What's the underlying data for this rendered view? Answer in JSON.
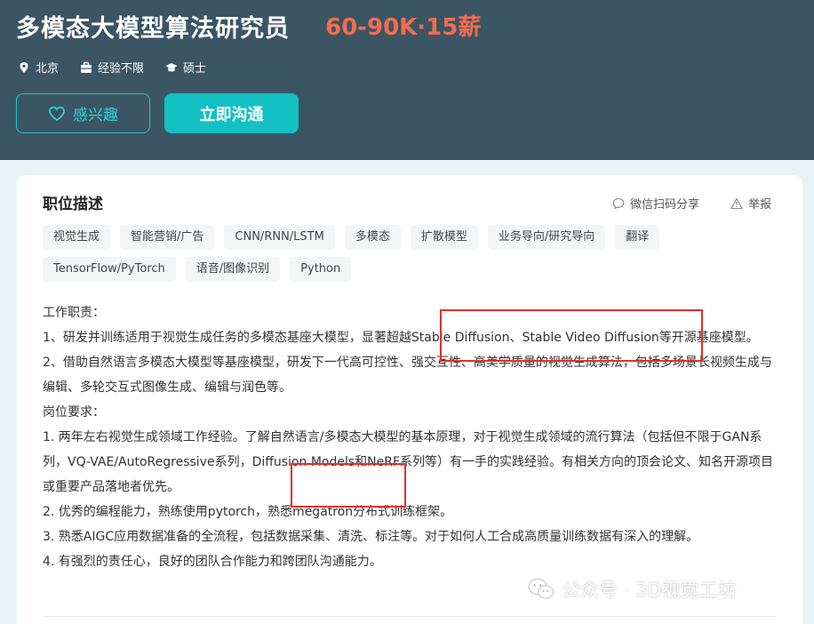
{
  "header": {
    "title": "多模态大模型算法研究员",
    "salary": "60-90K·15薪",
    "meta": {
      "location": "北京",
      "experience": "经验不限",
      "education": "硕士"
    },
    "interest_label": "感兴趣",
    "chat_label": "立即沟通"
  },
  "card": {
    "section_title": "职位描述",
    "share_label": "微信扫码分享",
    "report_label": "举报",
    "tags": [
      "视觉生成",
      "智能营销/广告",
      "CNN/RNN/LSTM",
      "多模态",
      "扩散模型",
      "业务导向/研究导向",
      "翻译",
      "TensorFlow/PyTorch",
      "语音/图像识别",
      "Python"
    ],
    "description": [
      "工作职责：",
      "1、研发并训练适用于视觉生成任务的多模态基座大模型，显著超越Stable Diffusion、Stable Video Diffusion等开源基座模型。",
      "2、借助自然语言多模态大模型等基座模型，研发下一代高可控性、强交互性、高美学质量的视觉生成算法，包括多场景长视频生成与编辑、多轮交互式图像生成、编辑与润色等。",
      "岗位要求：",
      "1. 两年左右视觉生成领域工作经验。了解自然语言/多模态大模型的基本原理，对于视觉生成领域的流行算法（包括但不限于GAN系列，VQ-VAE/AutoRegressive系列，Diffusion Models和NeRF系列等）有一手的实践经验。有相关方向的顶会论文、知名开源项目或重要产品落地者优先。",
      "2. 优秀的编程能力，熟练使用pytorch，熟悉megatron分布式训练框架。",
      "3. 熟悉AIGC应用数据准备的全流程，包括数据采集、清洗、标注等。对于如何人工合成高质量训练数据有深入的理解。",
      "4. 有强烈的责任心，良好的团队合作能力和跨团队沟通能力。"
    ]
  },
  "watermark": "公众号 · 3D视觉工坊",
  "colors": {
    "header_bg": "#3b5564",
    "salary": "#f26d4f",
    "accent": "#12c1c3",
    "highlight_box": "#e3302b"
  }
}
